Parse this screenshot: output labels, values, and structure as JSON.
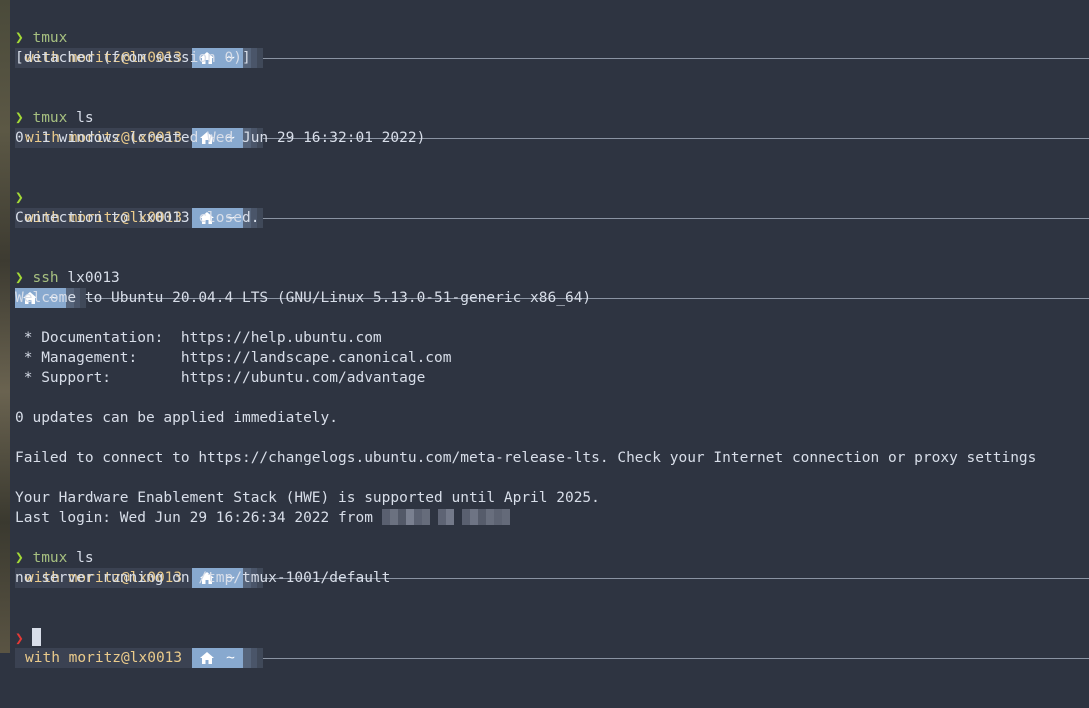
{
  "prompt": {
    "user_host": "with moritz@lx0013",
    "tilde": "~",
    "arrow": "❯"
  },
  "blocks": [
    {
      "id": "b1",
      "show_user": true,
      "command": "tmux",
      "args": "",
      "output": [
        "[detached (from session 0)]",
        ""
      ]
    },
    {
      "id": "b2",
      "show_user": true,
      "command": "tmux",
      "args": " ls",
      "output": [
        "0: 1 windows (created Wed Jun 29 16:32:01 2022)",
        ""
      ]
    },
    {
      "id": "b3",
      "show_user": true,
      "command": "",
      "args": "",
      "output": [
        "Connection to lx0013 closed.",
        ""
      ]
    },
    {
      "id": "b4",
      "show_user": false,
      "command": "ssh",
      "args": " lx0013",
      "output": [
        "Welcome to Ubuntu 20.04.4 LTS (GNU/Linux 5.13.0-51-generic x86_64)",
        "",
        " * Documentation:  https://help.ubuntu.com",
        " * Management:     https://landscape.canonical.com",
        " * Support:        https://ubuntu.com/advantage",
        "",
        "0 updates can be applied immediately.",
        "",
        "Failed to connect to https://changelogs.ubuntu.com/meta-release-lts. Check your Internet connection or proxy settings",
        "",
        "Your Hardware Enablement Stack (HWE) is supported until April 2025."
      ],
      "last_login": "Last login: Wed Jun 29 16:26:34 2022 from "
    },
    {
      "id": "b5",
      "show_user": true,
      "command": "tmux",
      "args": " ls",
      "output": [
        "no server running on /tmp/tmux-1001/default",
        ""
      ]
    }
  ],
  "colors": {
    "background": "#2e3441",
    "user_segment": "#3b4252",
    "user_text": "#ebcb8b",
    "dir_segment": "#88a9cf",
    "arrow_ok": "#a3d936",
    "arrow_error": "#e53935",
    "command": "#a7c080"
  },
  "icons": {
    "home": "home-icon"
  }
}
